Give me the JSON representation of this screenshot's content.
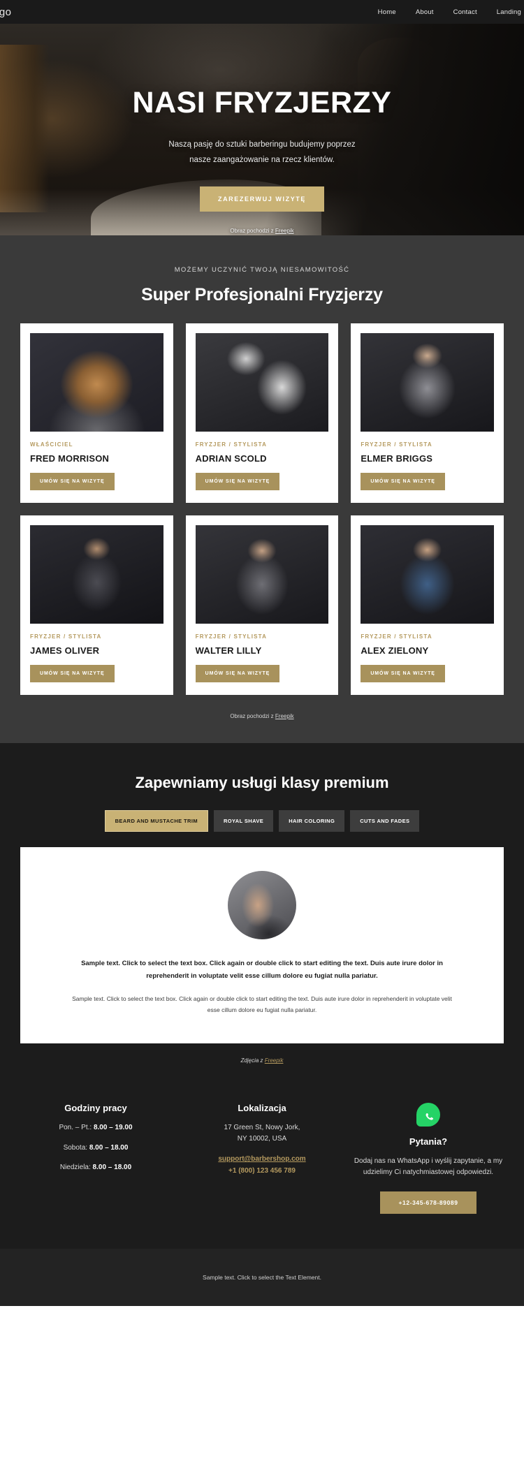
{
  "header": {
    "logo": "ogo",
    "nav": [
      {
        "label": "Home"
      },
      {
        "label": "About"
      },
      {
        "label": "Contact"
      },
      {
        "label": "Landing"
      }
    ]
  },
  "hero": {
    "title": "NASI FRYZJERZY",
    "subtitle_line1": "Naszą pasję do sztuki barberingu budujemy poprzez",
    "subtitle_line2": "nasze zaangażowanie na rzecz klientów.",
    "cta_label": "ZAREZERWUJ WIZYTĘ",
    "credit_prefix": "Obraz pochodzi z ",
    "credit_link": "Freepik"
  },
  "team": {
    "eyebrow": "MOŻEMY UCZYNIĆ TWOJĄ NIESAMOWITOŚĆ",
    "title": "Super Profesjonalni Fryzjerzy",
    "button_label": "UMÓW SIĘ NA WIZYTĘ",
    "members": [
      {
        "role": "WŁAŚCICIEL",
        "name": "FRED MORRISON"
      },
      {
        "role": "FRYZJER / STYLISTA",
        "name": "ADRIAN SCOLD"
      },
      {
        "role": "FRYZJER / STYLISTA",
        "name": "ELMER BRIGGS"
      },
      {
        "role": "FRYZJER / STYLISTA",
        "name": "JAMES OLIVER"
      },
      {
        "role": "FRYZJER / STYLISTA",
        "name": "WALTER LILLY"
      },
      {
        "role": "FRYZJER / STYLISTA",
        "name": "ALEX ZIELONY"
      }
    ],
    "credit_prefix": "Obraz pochodzi z ",
    "credit_link": "Freepik"
  },
  "services": {
    "title": "Zapewniamy usługi klasy premium",
    "tabs": [
      {
        "label": "BEARD AND MUSTACHE TRIM",
        "active": true
      },
      {
        "label": "ROYAL SHAVE",
        "active": false
      },
      {
        "label": "HAIR COLORING",
        "active": false
      },
      {
        "label": "CUTS AND FADES",
        "active": false
      }
    ],
    "lead": "Sample text. Click to select the text box. Click again or double click to start editing the text. Duis aute irure dolor in reprehenderit in voluptate velit esse cillum dolore eu fugiat nulla pariatur.",
    "body": "Sample text. Click to select the text box. Click again or double click to start editing the text. Duis aute irure dolor in reprehenderit in voluptate velit esse cillum dolore eu fugiat nulla pariatur.",
    "credit_prefix": "Zdjęcia z ",
    "credit_link": "Freepik"
  },
  "contact": {
    "hours": {
      "heading": "Godziny pracy",
      "rows": [
        {
          "label": "Pon. – Pt.: ",
          "value": "8.00 – 19.00"
        },
        {
          "label": "Sobota: ",
          "value": "8.00 – 18.00"
        },
        {
          "label": "Niedziela: ",
          "value": "8.00 – 18.00"
        }
      ]
    },
    "location": {
      "heading": "Lokalizacja",
      "address_line1": "17 Green St, Nowy Jork,",
      "address_line2": "NY 10002, USA",
      "email": "support@barbershop.com",
      "phone": "+1 (800) 123 456 789"
    },
    "questions": {
      "icon": "whatsapp-icon",
      "heading": "Pytania?",
      "text": "Dodaj nas na WhatsApp i wyślij zapytanie, a my udzielimy Ci natychmiastowej odpowiedzi.",
      "button_label": "+12-345-678-89089"
    }
  },
  "footer": {
    "text": "Sample text. Click to select the Text Element."
  },
  "colors": {
    "gold": "#c9b275",
    "gold_dark": "#a8925c",
    "whatsapp_green": "#25d366",
    "dark_bg": "#1c1c1c",
    "team_bg": "#3a3a3a"
  }
}
